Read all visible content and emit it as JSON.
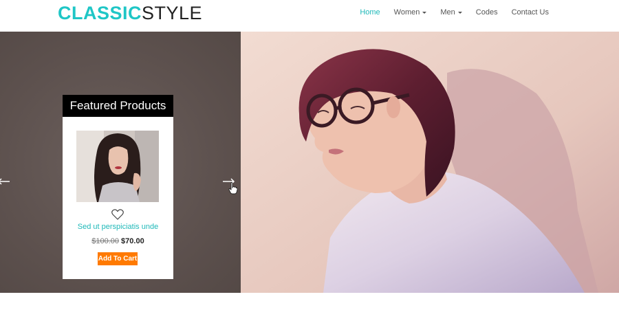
{
  "header": {
    "logo_bold": "CLASSIC",
    "logo_light": "STYLE",
    "nav": {
      "home": "Home",
      "women": "Women",
      "men": "Men",
      "codes": "Codes",
      "contact": "Contact Us"
    }
  },
  "featured": {
    "title": "Featured Products",
    "product_name": "Sed ut perspiciatis unde",
    "old_price": "$100.00",
    "new_price": "$70.00",
    "cart_button": "Add To Cart"
  },
  "colors": {
    "brand_accent": "#1fc6c6",
    "cart_button": "#ff7a00",
    "hero_panel": "#5d514e"
  },
  "icons": [
    "caret-down-icon",
    "arrow-left-icon",
    "arrow-right-icon",
    "heart-icon",
    "hand-cursor-icon"
  ]
}
